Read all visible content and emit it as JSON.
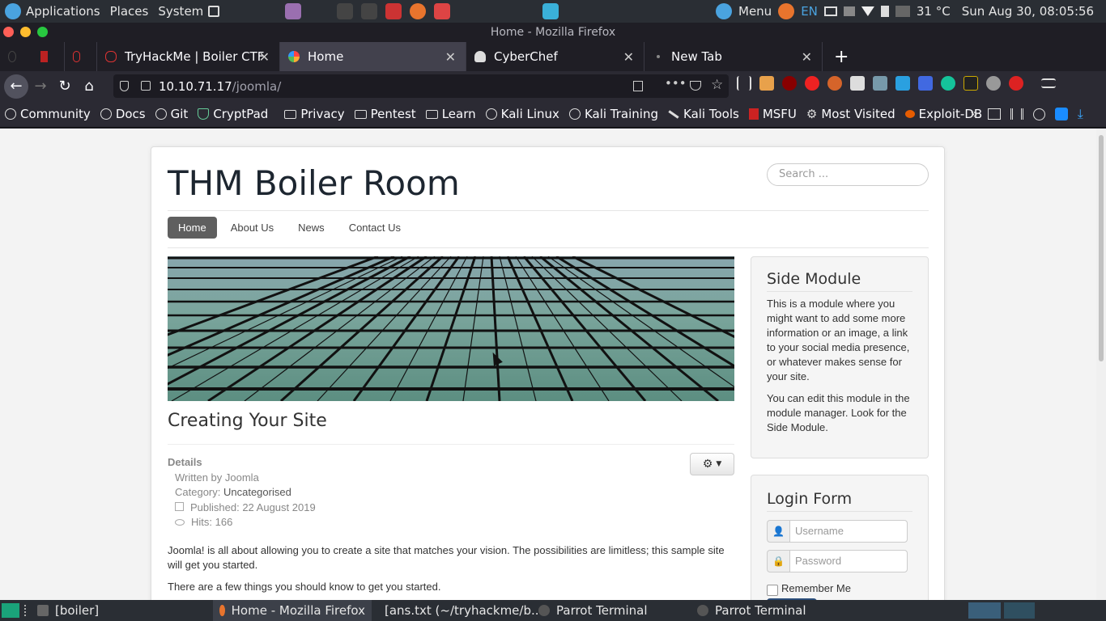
{
  "panel": {
    "applications": "Applications",
    "places": "Places",
    "system": "System",
    "menu": "Menu",
    "lang": "EN",
    "temp": "31 °C",
    "datetime": "Sun Aug 30, 08:05:56"
  },
  "window": {
    "title": "Home - Mozilla Firefox"
  },
  "tabs": [
    {
      "label": "TryHackMe | Boiler CTF",
      "icon": "tryhackme-icon"
    },
    {
      "label": "Home",
      "icon": "joomla-icon",
      "active": true
    },
    {
      "label": "CyberChef",
      "icon": "cyberchef-icon"
    },
    {
      "label": "New Tab",
      "icon": "newtab-icon"
    }
  ],
  "urlbar": {
    "host": "10.10.71.17",
    "path": "/joomla/"
  },
  "bookmarks": [
    {
      "label": "Community",
      "icon": "globe-icon"
    },
    {
      "label": "Docs",
      "icon": "globe-icon"
    },
    {
      "label": "Git",
      "icon": "globe-icon"
    },
    {
      "label": "CryptPad",
      "icon": "shield-icon"
    },
    {
      "label": "Privacy",
      "icon": "folder-icon"
    },
    {
      "label": "Pentest",
      "icon": "folder-icon"
    },
    {
      "label": "Learn",
      "icon": "folder-icon"
    },
    {
      "label": "Kali Linux",
      "icon": "globe-icon"
    },
    {
      "label": "Kali Training",
      "icon": "globe-icon"
    },
    {
      "label": "Kali Tools",
      "icon": "kali-icon"
    },
    {
      "label": "MSFU",
      "icon": "msfu-icon"
    },
    {
      "label": "Most Visited",
      "icon": "gear-icon"
    },
    {
      "label": "Exploit-DB",
      "icon": "exploitdb-icon"
    }
  ],
  "site": {
    "title": "THM Boiler Room",
    "search_placeholder": "Search ...",
    "nav": [
      "Home",
      "About Us",
      "News",
      "Contact Us"
    ],
    "article": {
      "title": "Creating Your Site",
      "details_label": "Details",
      "written_by": "Written by Joomla",
      "category_label": "Category: ",
      "category": "Uncategorised",
      "published": "Published: 22 August 2019",
      "hits": "Hits: 166",
      "para1": "Joomla! is all about allowing you to create a site that matches your vision. The possibilities are limitless; this sample site will get you started.",
      "para2": "There are a few things you should know to get you started."
    },
    "side_module": {
      "title": "Side Module",
      "p1": "This is a module where you might want to add some more information or an image, a link to your social media presence, or whatever makes sense for your site.",
      "p2": "You can edit this module in the module manager. Look for the Side Module."
    },
    "login": {
      "title": "Login Form",
      "username_placeholder": "Username",
      "password_placeholder": "Password",
      "remember": "Remember Me"
    }
  },
  "taskbar": [
    {
      "label": "[boiler]",
      "icon": "folder-icon"
    },
    {
      "label": "Home - Mozilla Firefox",
      "icon": "firefox-icon",
      "active": true
    },
    {
      "label": "[ans.txt (~/tryhackme/b...",
      "icon": "editor-icon"
    },
    {
      "label": "Parrot Terminal",
      "icon": "terminal-icon"
    },
    {
      "label": "Parrot Terminal",
      "icon": "terminal-icon"
    }
  ]
}
